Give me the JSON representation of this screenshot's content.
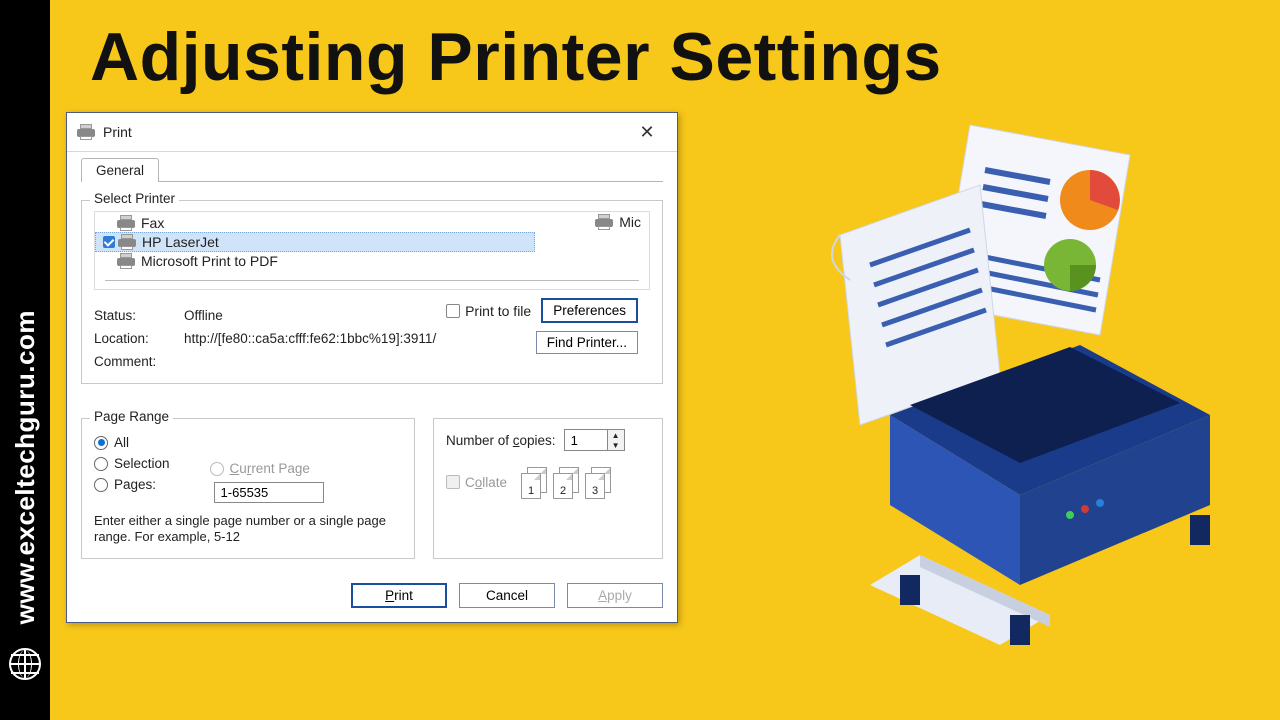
{
  "sidebar": {
    "url": "www.exceltechguru.com"
  },
  "page": {
    "title": "Adjusting Printer Settings"
  },
  "dialog": {
    "title": "Print",
    "tab": "General",
    "select_printer_label": "Select Printer",
    "printers": {
      "fax": "Fax",
      "hp": "HP LaserJet",
      "mspdf": "Microsoft Print to PDF",
      "mic": "Mic"
    },
    "status_label": "Status:",
    "status_value": "Offline",
    "location_label": "Location:",
    "location_value": "http://[fe80::ca5a:cfff:fe62:1bbc%19]:3911/",
    "comment_label": "Comment:",
    "print_to_file_label": "Print to file",
    "preferences_button": "Preferences",
    "find_printer_button": "Find Printer...",
    "page_range": {
      "label": "Page Range",
      "all": "All",
      "selection": "Selection",
      "current_page": "Current Page",
      "pages": "Pages:",
      "pages_value": "1-65535",
      "help": "Enter either a single page number or a single page range.  For example, 5-12"
    },
    "copies": {
      "number_label_prefix": "Number of ",
      "number_label_ul": "c",
      "number_label_suffix": "opies:",
      "value": "1",
      "collate_prefix": "C",
      "collate_ul": "o",
      "collate_suffix": "llate",
      "pair1": "1",
      "pair2": "2",
      "pair3": "3"
    },
    "footer": {
      "print_prefix": "",
      "print_ul": "P",
      "print_suffix": "rint",
      "cancel": "Cancel",
      "apply_prefix": "",
      "apply_ul": "A",
      "apply_suffix": "pply"
    }
  }
}
